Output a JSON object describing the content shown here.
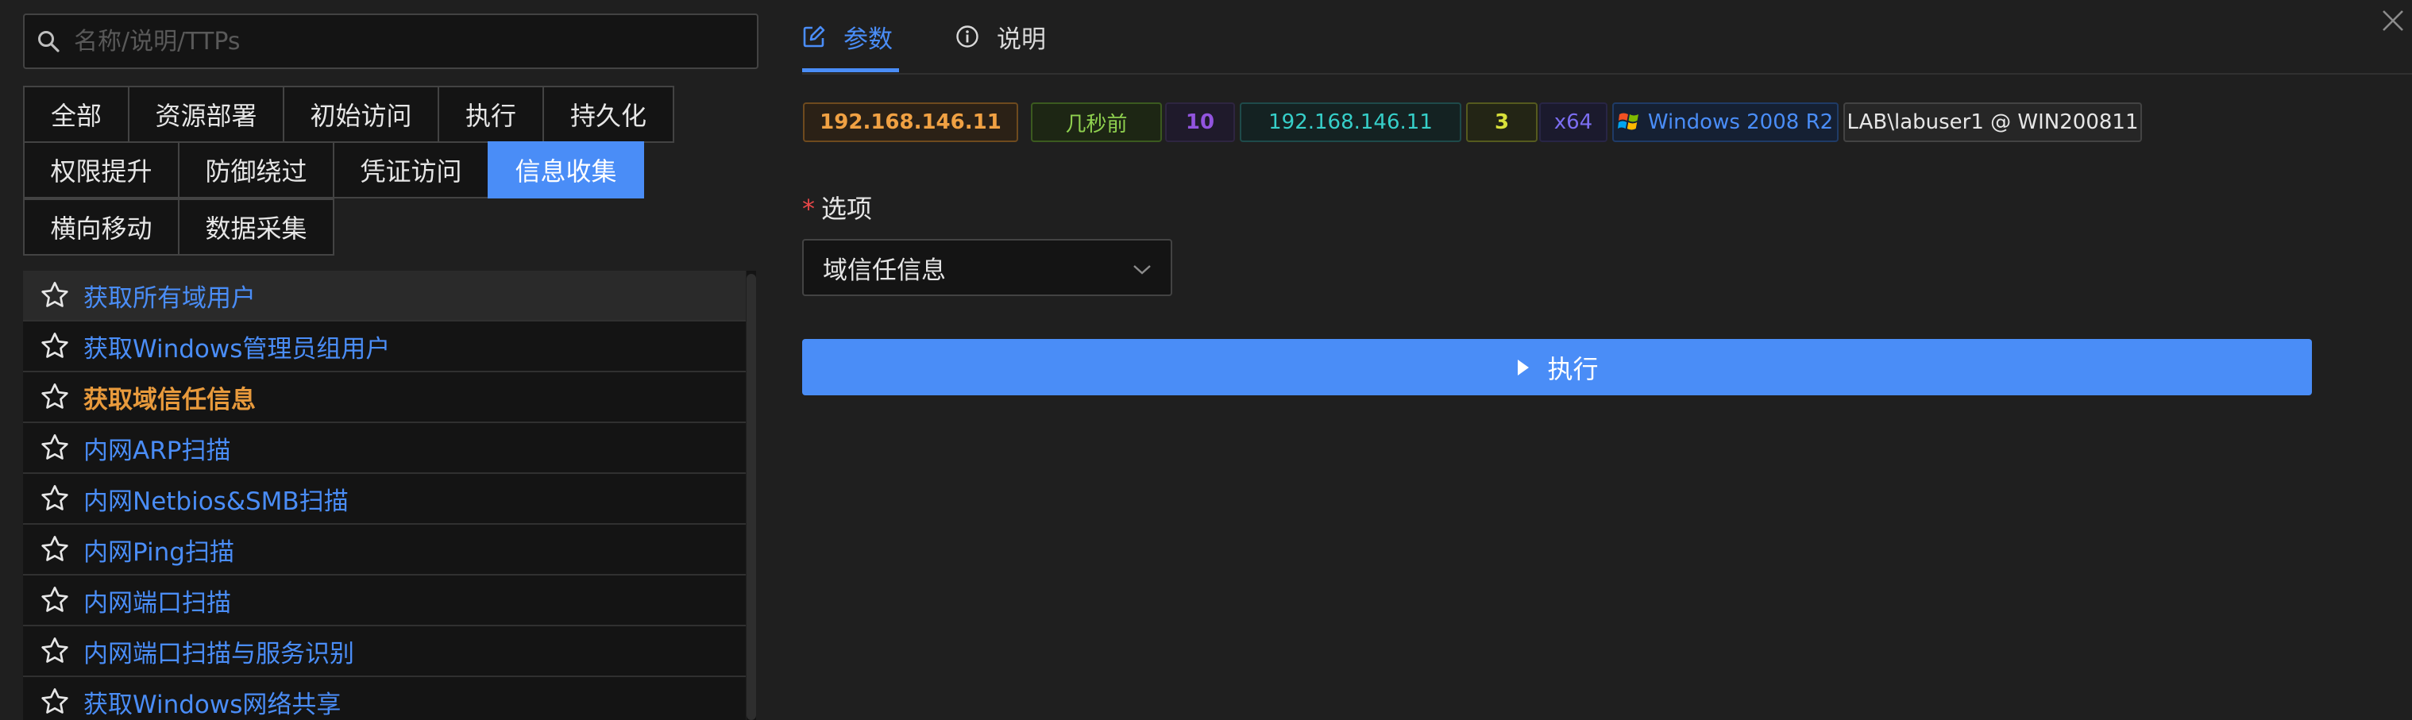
{
  "search": {
    "placeholder": "名称/说明/TTPs"
  },
  "tactic_tabs": [
    [
      "全部",
      "资源部署",
      "初始访问",
      "执行",
      "持久化"
    ],
    [
      "权限提升",
      "防御绕过",
      "凭证访问",
      "信息收集"
    ],
    [
      "横向移动",
      "数据采集"
    ]
  ],
  "active_tactic": "信息收集",
  "techniques": [
    {
      "label": "获取所有域用户",
      "state": "hover"
    },
    {
      "label": "获取Windows管理员组用户",
      "state": "normal"
    },
    {
      "label": "获取域信任信息",
      "state": "selected"
    },
    {
      "label": "内网ARP扫描",
      "state": "normal"
    },
    {
      "label": "内网Netbios&SMB扫描",
      "state": "normal"
    },
    {
      "label": "内网Ping扫描",
      "state": "normal"
    },
    {
      "label": "内网端口扫描",
      "state": "normal"
    },
    {
      "label": "内网端口扫描与服务识别",
      "state": "normal"
    },
    {
      "label": "获取Windows网络共享",
      "state": "normal"
    }
  ],
  "right_tabs": {
    "params": "参数",
    "docs": "说明"
  },
  "session": {
    "ip": "192.168.146.11",
    "last_seen": "几秒前",
    "pid": "10",
    "internal_ip": "192.168.146.11",
    "arch_id": "3",
    "arch": "x64",
    "os": "Windows 2008 R2",
    "user_host": "LAB\\labuser1 @ WIN200811"
  },
  "colors": {
    "accent": "#4a8df7",
    "selected_technique": "#e89a3c",
    "required_mark": "#e84749",
    "chip_ip": "#f0a143",
    "chip_time": "#8fd14f",
    "chip_pid": "#9254de",
    "chip_internal_ip": "#36cfc9",
    "chip_arch_id": "#d8e03a",
    "chip_arch": "#7b6df0",
    "chip_os": "#4a8df7"
  },
  "form": {
    "option_label": "选项",
    "option_value": "域信任信息"
  },
  "run_button": {
    "label": "执行"
  },
  "icons": {
    "search": "search-icon",
    "star": "star-icon",
    "edit": "edit-icon",
    "info": "info-icon",
    "close": "close-icon",
    "windows": "windows-logo-icon",
    "chevron": "chevron-down-icon",
    "play": "play-icon"
  }
}
